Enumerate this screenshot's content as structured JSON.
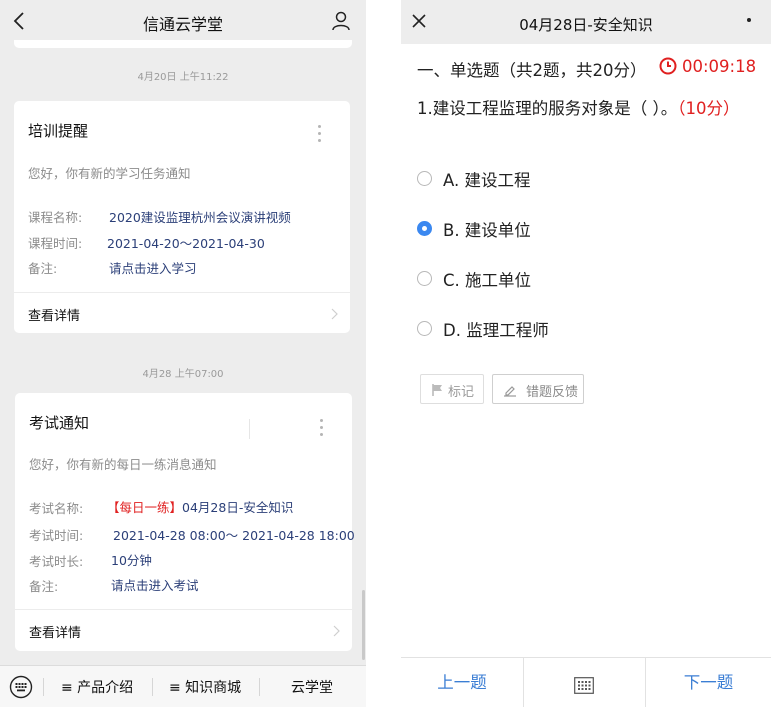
{
  "left": {
    "header": {
      "title": "信通云学堂",
      "back_icon": "chevron-left-icon",
      "user_icon": "user-icon"
    },
    "messages": [
      {
        "time": "4月20日 上午11:22",
        "title": "培训提醒",
        "intro": "您好，你有新的学习任务通知",
        "rows": [
          {
            "label": "课程名称:",
            "value": "2020建设监理杭州会议演讲视频"
          },
          {
            "label": "课程时间:",
            "value": "2021-04-20～2021-04-30"
          },
          {
            "label": "备注:",
            "value": "请点击进入学习"
          }
        ],
        "detail": "查看详情"
      },
      {
        "time": "4月28 上午07:00",
        "title": "考试通知",
        "intro": "您好，你有新的每日一练消息通知",
        "rows": [
          {
            "label": "考试名称:",
            "tag": "【每日一练】",
            "value": "04月28日-安全知识"
          },
          {
            "label": "考试时间:",
            "value": "2021-04-28 08:00～ 2021-04-28 18:00"
          },
          {
            "label": "考试时长:",
            "value": "10分钟"
          },
          {
            "label": "备注:",
            "value": "请点击进入考试"
          }
        ],
        "detail": "查看详情"
      }
    ],
    "menu": {
      "keyboard_icon": "keyboard-icon",
      "items": [
        "≡ 产品介绍",
        "≡ 知识商城",
        "云学堂"
      ]
    }
  },
  "right": {
    "header": {
      "title": "04月28日-安全知识",
      "close_icon": "close-icon"
    },
    "section": "一、单选题（共2题，共20分）",
    "timer": "00:09:18",
    "question": {
      "text": "1.建设工程监理的服务对象是（ ）。",
      "score": "（10分）"
    },
    "options": [
      {
        "label": "A. 建设工程",
        "selected": false
      },
      {
        "label": "B. 建设单位",
        "selected": true
      },
      {
        "label": "C. 施工单位",
        "selected": false
      },
      {
        "label": "D. 监理工程师",
        "selected": false
      }
    ],
    "actions": {
      "mark": "标记",
      "report": "错题反馈"
    },
    "footer": {
      "prev": "上一题",
      "next": "下一题",
      "grid_icon": "answer-sheet-icon"
    },
    "colors": {
      "accent_blue": "#3b88f0",
      "red": "#e02020"
    }
  }
}
